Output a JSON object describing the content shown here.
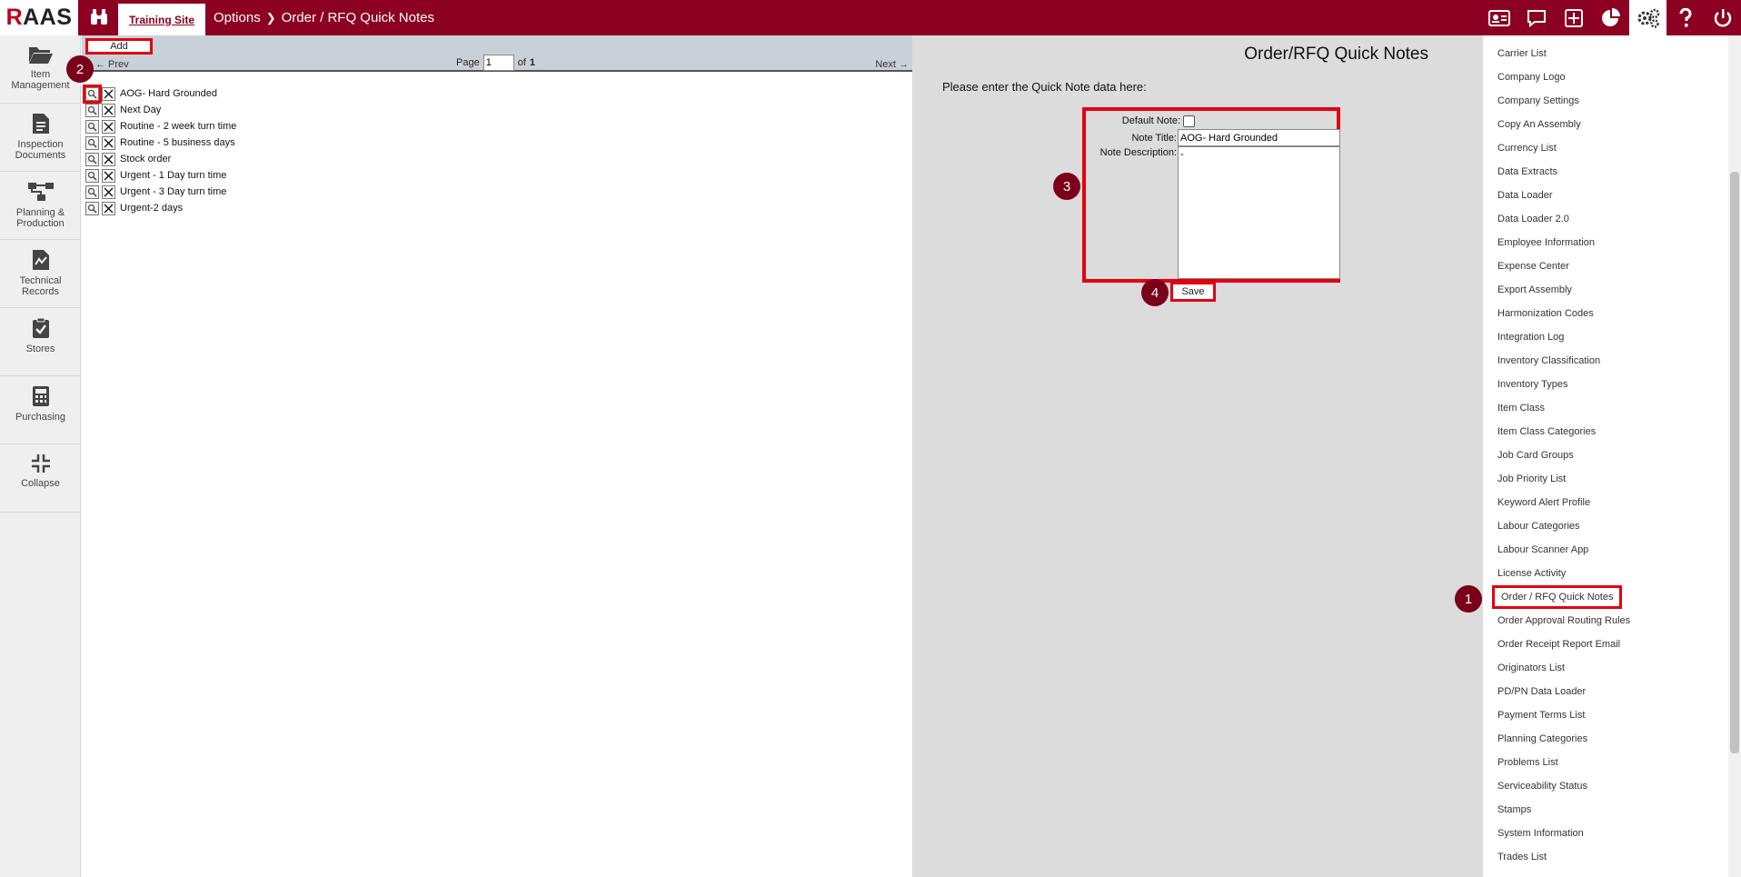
{
  "app": {
    "logo_text": "RAAS",
    "site_tab": "Training Site",
    "breadcrumb": [
      "Options",
      "Order / RFQ Quick Notes"
    ]
  },
  "top_icons": [
    "id-card-icon",
    "chat-icon",
    "plus-square-icon",
    "pie-chart-icon",
    "gears-icon",
    "help-icon",
    "power-icon"
  ],
  "sidebar": {
    "items": [
      {
        "label": "Item Management",
        "icon": "folder-open-icon"
      },
      {
        "label": "Inspection Documents",
        "icon": "document-icon"
      },
      {
        "label": "Planning & Production",
        "icon": "flow-icon"
      },
      {
        "label": "Technical Records",
        "icon": "chart-file-icon"
      },
      {
        "label": "Stores",
        "icon": "clipboard-check-icon"
      },
      {
        "label": "Purchasing",
        "icon": "calculator-icon"
      },
      {
        "label": "Collapse",
        "icon": "compress-icon"
      }
    ]
  },
  "list": {
    "add_label": "Add",
    "prev_label": "← Prev",
    "next_label": "Next →",
    "page_label": "Page",
    "page_value": "1",
    "of_label": "of",
    "total_pages": "1",
    "notes": [
      "AOG- Hard Grounded",
      "Next Day",
      "Routine - 2 week turn time",
      "Routine - 5 business days",
      "Stock order",
      "Urgent - 1 Day turn time",
      "Urgent - 3 Day turn time",
      "Urgent-2 days"
    ]
  },
  "form": {
    "heading": "Order/RFQ Quick Notes",
    "prompt": "Please enter the Quick Note data here:",
    "default_note_label": "Default Note:",
    "default_note_checked": false,
    "note_title_label": "Note Title:",
    "note_title_value": "AOG- Hard Grounded",
    "note_desc_label": "Note Description:",
    "note_desc_value": "-",
    "save_label": "Save"
  },
  "badges": [
    "1",
    "2",
    "3",
    "4"
  ],
  "options_menu": {
    "active": "Order / RFQ Quick Notes",
    "items": [
      "Carrier List",
      "Company Logo",
      "Company Settings",
      "Copy An Assembly",
      "Currency List",
      "Data Extracts",
      "Data Loader",
      "Data Loader 2.0",
      "Employee Information",
      "Expense Center",
      "Export Assembly",
      "Harmonization Codes",
      "Integration Log",
      "Inventory Classification",
      "Inventory Types",
      "Item Class",
      "Item Class Categories",
      "Job Card Groups",
      "Job Priority List",
      "Keyword Alert Profile",
      "Labour Categories",
      "Labour Scanner App",
      "License Activity",
      "Order / RFQ Quick Notes",
      "Order Approval Routing Rules",
      "Order Receipt Report Email",
      "Originators List",
      "PD/PN Data Loader",
      "Payment Terms List",
      "Planning Categories",
      "Problems List",
      "Serviceability Status",
      "Stamps",
      "System Information",
      "Trades List"
    ]
  },
  "colors": {
    "brand": "#8c0022",
    "highlight": "#e3000f",
    "badge": "#7a0019"
  }
}
